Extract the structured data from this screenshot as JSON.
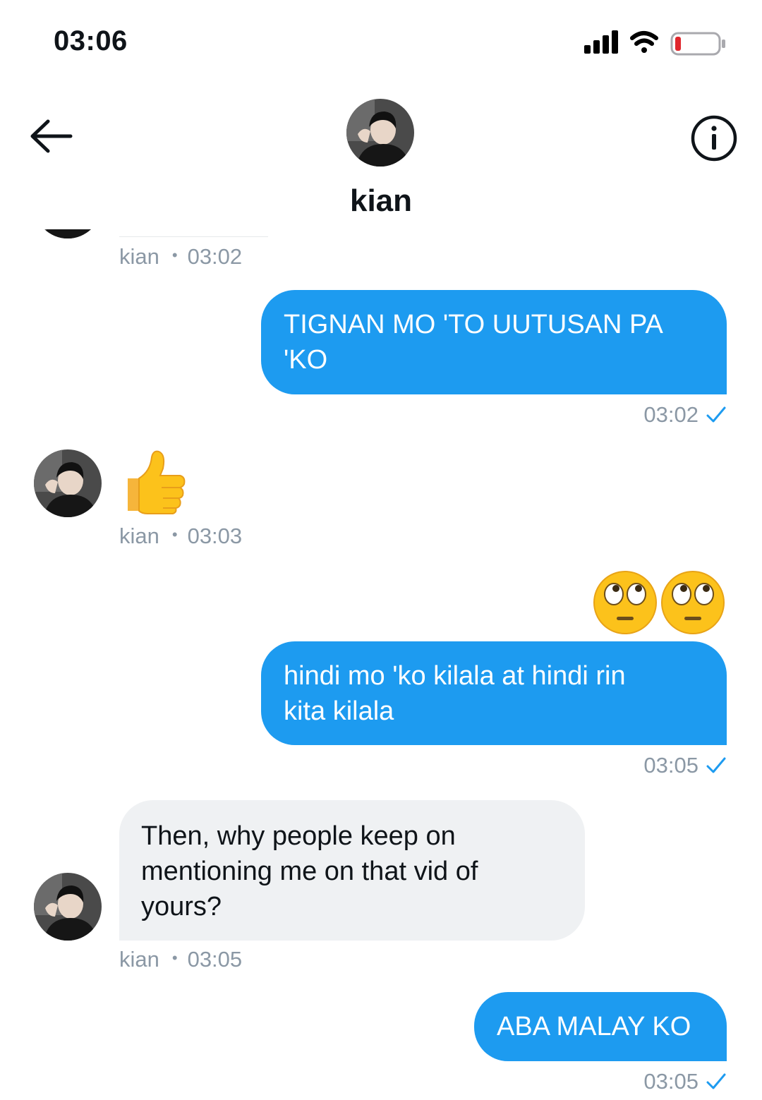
{
  "status_bar": {
    "time": "03:06"
  },
  "header": {
    "name": "kian"
  },
  "messages": [
    {
      "direction": "in",
      "type": "cutoff",
      "sender": "kian",
      "time": "03:02"
    },
    {
      "direction": "out",
      "type": "text",
      "text": "TIGNAN MO 'TO UUTUSAN PA\n'KO",
      "time": "03:02"
    },
    {
      "direction": "in",
      "type": "emoji",
      "emoji": "thumbs-up",
      "sender": "kian",
      "time": "03:03"
    },
    {
      "direction": "out",
      "type": "emoji",
      "emoji": "rolling-eyes ×2"
    },
    {
      "direction": "out",
      "type": "text",
      "text": "hindi mo 'ko kilala at hindi rin\nkita kilala",
      "time": "03:05"
    },
    {
      "direction": "in",
      "type": "text",
      "text": "Then, why people keep on\nmentioning me on that vid of\nyours?",
      "sender": "kian",
      "time": "03:05"
    },
    {
      "direction": "out",
      "type": "text",
      "text": "ABA MALAY KO",
      "time": "03:05"
    }
  ],
  "colors": {
    "sent_bubble": "#1d9bf0",
    "received_bubble": "#eff1f3",
    "meta_text": "#8b98a5",
    "read_check": "#1d9bf0",
    "battery_low": "#e0262c"
  },
  "icons": {
    "back": "arrow-left-icon",
    "info": "info-circle-icon",
    "signal": "cellular-signal-icon",
    "wifi": "wifi-icon",
    "battery": "battery-low-icon",
    "read": "check-icon"
  }
}
